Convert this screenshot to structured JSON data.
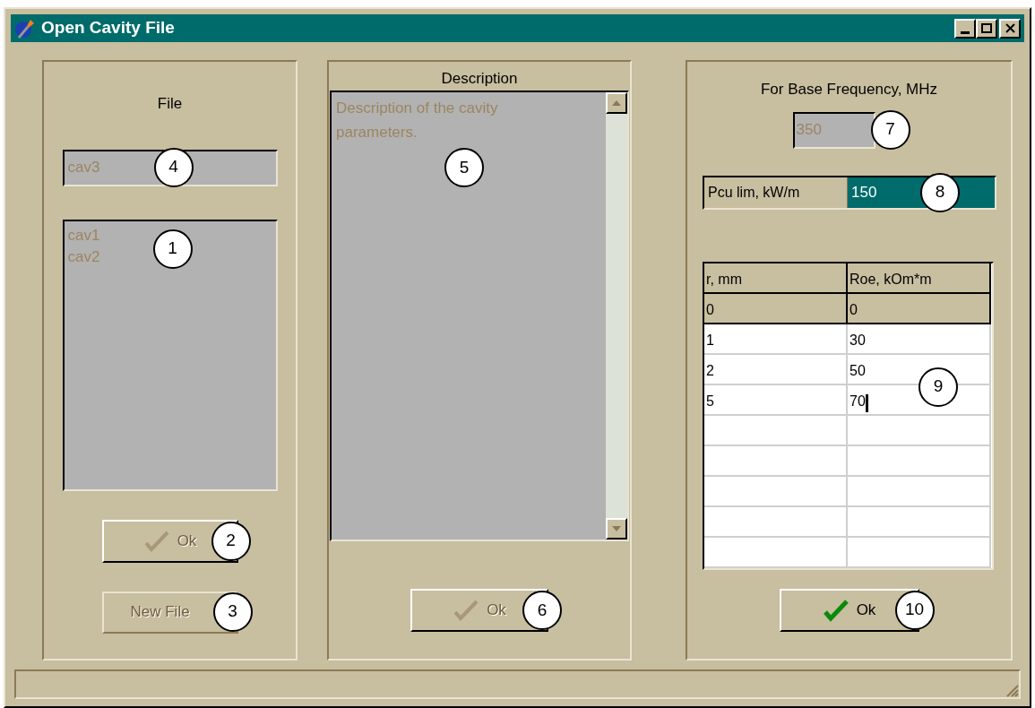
{
  "window": {
    "title": "Open Cavity File"
  },
  "file_panel": {
    "label": "File",
    "name_field": {
      "value": "cav3",
      "disabled": true,
      "callout": "4"
    },
    "file_list": {
      "items": [
        "cav1",
        "cav2"
      ],
      "disabled": true,
      "callout": "1"
    },
    "ok_button": {
      "label": "Ok",
      "disabled": true,
      "callout": "2"
    },
    "new_file_button": {
      "label": "New File",
      "disabled": true,
      "callout": "3"
    }
  },
  "description_panel": {
    "title": "Description",
    "memo": {
      "text": "Description of the cavity parameters.",
      "disabled": true,
      "callout": "5"
    },
    "ok_button": {
      "label": "Ok",
      "disabled": true,
      "callout": "6"
    }
  },
  "frequency_panel": {
    "label": "For Base Frequency, MHz",
    "frequency_field": {
      "value": "350",
      "disabled": true,
      "callout": "7"
    },
    "pcu_field": {
      "label": "Pcu lim, kW/m",
      "value": "150",
      "selected": true,
      "callout": "8"
    },
    "table": {
      "columns": [
        "r, mm",
        "Roe, kOm*m"
      ],
      "callout": "9",
      "rows": [
        {
          "cells": [
            "0",
            "0"
          ],
          "fixed": true,
          "editing": false
        },
        {
          "cells": [
            "1",
            "30"
          ],
          "fixed": false,
          "editing": false
        },
        {
          "cells": [
            "2",
            "50"
          ],
          "fixed": false,
          "editing": false
        },
        {
          "cells": [
            "5",
            "70"
          ],
          "fixed": false,
          "editing": true
        }
      ]
    },
    "ok_button": {
      "label": "Ok",
      "disabled": false,
      "callout": "10"
    }
  }
}
